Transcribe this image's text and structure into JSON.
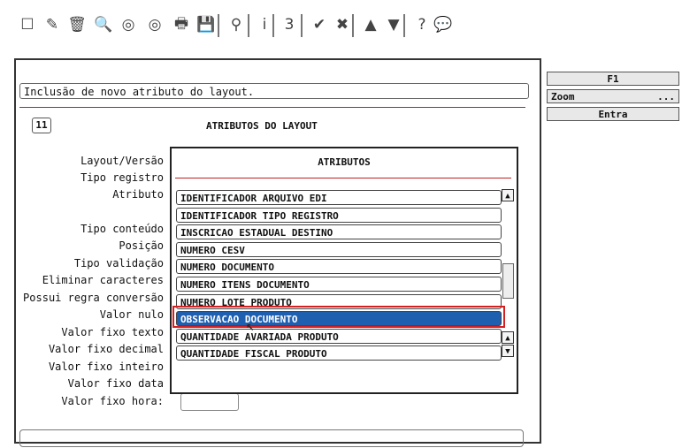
{
  "toolbar": {
    "icons": [
      "new-doc-icon",
      "edit-icon",
      "trash-icon",
      "search-icon",
      "circle-icon",
      "circle-icon-2",
      "print-icon",
      "save-icon",
      "binoculars-icon",
      "info-icon",
      "sort-icon",
      "check-icon",
      "cancel-icon",
      "up-icon",
      "down-icon",
      "help-icon",
      "chat-icon"
    ],
    "glyphs": [
      "☐",
      "✎",
      "🗑",
      "🔍",
      "◎",
      "◎",
      "🖶",
      "💾",
      "⚲",
      "i",
      "3",
      "✔",
      "✖",
      "▲",
      "▼",
      "?",
      "💬"
    ]
  },
  "message": "Inclusão de novo atributo do layout.",
  "section_number": "11",
  "section_title": "ATRIBUTOS DO LAYOUT",
  "fields": [
    "Layout/Versão",
    "Tipo registro",
    "Atributo",
    "Tipo conteúdo",
    "Posição",
    "Tipo validação",
    "Eliminar caracteres",
    "Possui regra conversão",
    "Valor nulo",
    "Valor fixo texto",
    "Valor fixo decimal",
    "Valor fixo inteiro",
    "Valor fixo data",
    "Valor fixo hora:"
  ],
  "side_panel": {
    "f1": "F1",
    "zoom": "Zoom",
    "zoom_dots": "...",
    "entra": "Entra"
  },
  "dialog": {
    "title": "ATRIBUTOS",
    "items": [
      "IDENTIFICADOR ARQUIVO EDI",
      "IDENTIFICADOR TIPO REGISTRO",
      "INSCRICAO ESTADUAL DESTINO",
      "NUMERO CESV",
      "NUMERO DOCUMENTO",
      "NUMERO ITENS DOCUMENTO",
      "NUMERO LOTE PRODUTO",
      "OBSERVACAO DOCUMENTO",
      "QUANTIDADE AVARIADA PRODUTO",
      "QUANTIDADE FISCAL PRODUTO"
    ],
    "selected_index": 7,
    "colors": {
      "selection": "#1f5fb0",
      "highlight": "#d42020"
    }
  }
}
